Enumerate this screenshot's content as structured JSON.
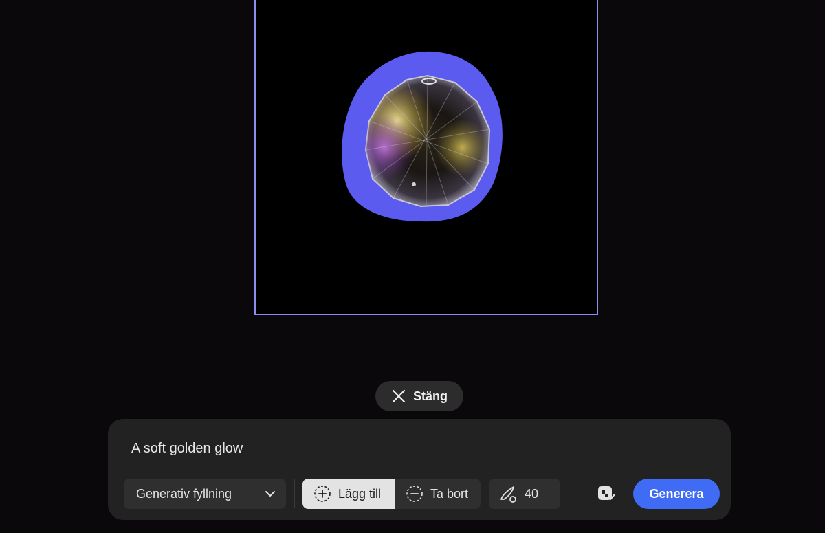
{
  "canvas": {
    "selection_color": "#5b5bf0",
    "frame_color": "#8f8cf0",
    "subject": "crystal-ball-image"
  },
  "close_button": {
    "label": "Stäng",
    "icon": "close-icon"
  },
  "prompt": {
    "value": "A soft golden glow",
    "placeholder": ""
  },
  "toolbar": {
    "mode_select": {
      "selected": "Generativ fyllning",
      "icon": "chevron-down-icon"
    },
    "add_button": {
      "label": "Lägg till",
      "icon": "add-selection-icon",
      "active": true
    },
    "remove_button": {
      "label": "Ta bort",
      "icon": "subtract-selection-icon"
    },
    "brush": {
      "size": "40",
      "icon": "brush-icon"
    },
    "aux_icon": "generate-settings-icon",
    "generate_button": {
      "label": "Generera",
      "color": "#3f6bf5"
    }
  }
}
